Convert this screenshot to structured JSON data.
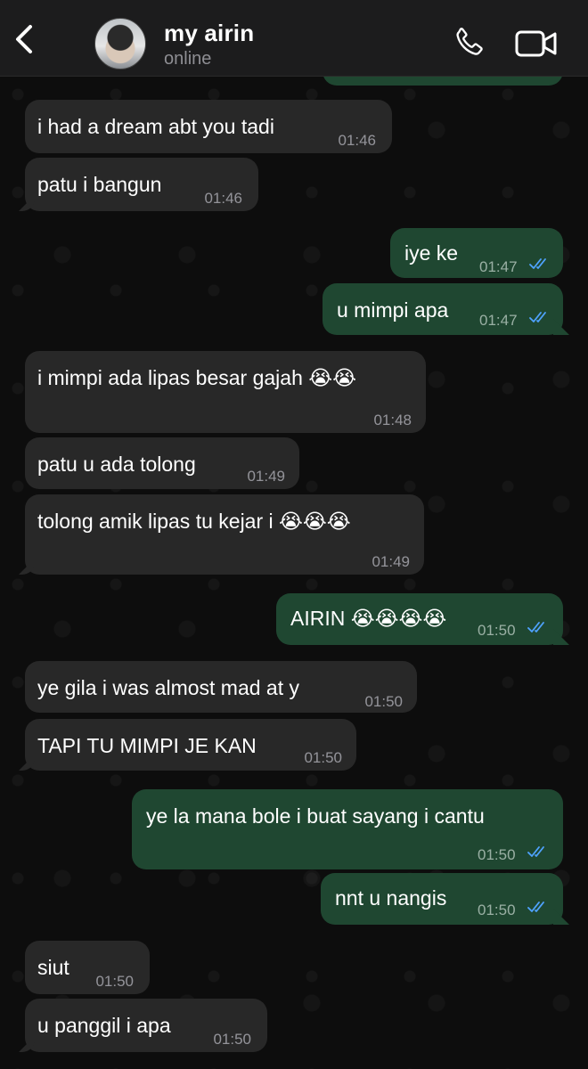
{
  "header": {
    "contact_name": "my airin",
    "status": "online"
  },
  "colors": {
    "incoming_bubble": "#282828",
    "outgoing_bubble": "#1f4731",
    "read_ticks": "#4fa3ff",
    "header_bg": "#1c1c1d"
  },
  "messages": [
    {
      "direction": "incoming",
      "text": "i had a dream abt you tadi",
      "time": "01:46"
    },
    {
      "direction": "incoming",
      "text": "patu i bangun",
      "time": "01:46"
    },
    {
      "direction": "outgoing",
      "text": "iye ke",
      "time": "01:47",
      "status": "read"
    },
    {
      "direction": "outgoing",
      "text": "u mimpi apa",
      "time": "01:47",
      "status": "read"
    },
    {
      "direction": "incoming",
      "text": "i mimpi ada lipas besar gajah 😭😭",
      "time": "01:48"
    },
    {
      "direction": "incoming",
      "text": "patu u ada tolong",
      "time": "01:49"
    },
    {
      "direction": "incoming",
      "text": "tolong amik lipas tu kejar i 😭😭😭",
      "time": "01:49"
    },
    {
      "direction": "outgoing",
      "text": "AIRIN 😭😭😭😭",
      "time": "01:50",
      "status": "read"
    },
    {
      "direction": "incoming",
      "text": "ye gila i was almost mad at y",
      "time": "01:50"
    },
    {
      "direction": "incoming",
      "text": "TAPI TU MIMPI JE KAN",
      "time": "01:50"
    },
    {
      "direction": "outgoing",
      "text": "ye la mana bole i buat sayang i cantu",
      "time": "01:50",
      "status": "read"
    },
    {
      "direction": "outgoing",
      "text": "nnt u nangis",
      "time": "01:50",
      "status": "read"
    },
    {
      "direction": "incoming",
      "text": "siut",
      "time": "01:50"
    },
    {
      "direction": "incoming",
      "text": "u panggil i apa",
      "time": "01:50"
    }
  ]
}
